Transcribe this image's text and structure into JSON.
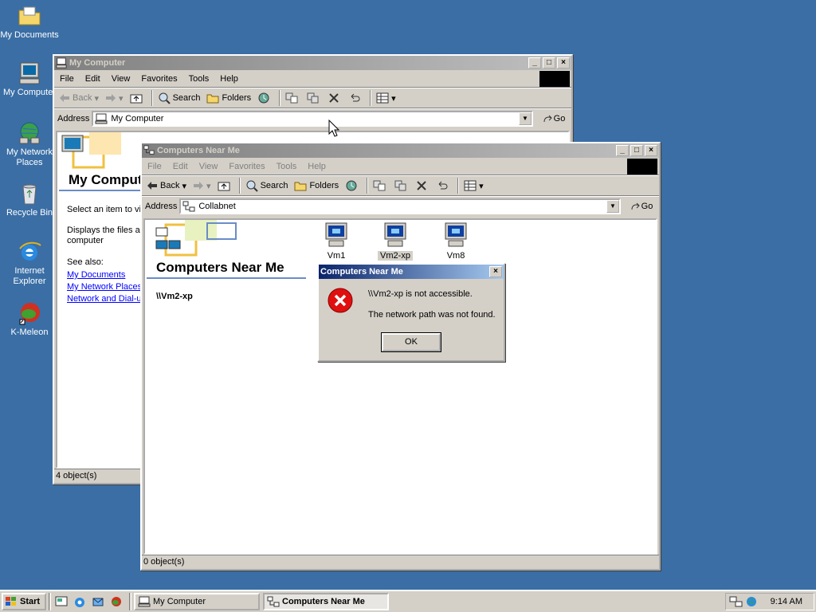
{
  "desktop": {
    "icons": [
      {
        "label": "My Documents"
      },
      {
        "label": "My Computer"
      },
      {
        "label": "My Network Places"
      },
      {
        "label": "Recycle Bin"
      },
      {
        "label": "Internet Explorer"
      },
      {
        "label": "K-Meleon"
      }
    ]
  },
  "win_mycomputer": {
    "title": "My Computer",
    "menu": [
      "File",
      "Edit",
      "View",
      "Favorites",
      "Tools",
      "Help"
    ],
    "toolbar": {
      "back": "Back",
      "search": "Search",
      "folders": "Folders"
    },
    "address_label": "Address",
    "address_value": "My Computer",
    "go": "Go",
    "heading": "My Computer",
    "select_text": "Select an item to vi",
    "displays_text": "Displays the files and folders on your computer",
    "displays_line1": "Displays the files ar",
    "displays_line2": "computer",
    "see_also": "See also:",
    "links": [
      "My Documents",
      "My Network Places",
      "Network and Dial-up"
    ],
    "status": "4 object(s)"
  },
  "win_near": {
    "title": "Computers Near Me",
    "menu": [
      "File",
      "Edit",
      "View",
      "Favorites",
      "Tools",
      "Help"
    ],
    "toolbar": {
      "back": "Back",
      "search": "Search",
      "folders": "Folders"
    },
    "address_label": "Address",
    "address_value": "Collabnet",
    "go": "Go",
    "heading": "Computers Near Me",
    "selected_item": "\\\\Vm2-xp",
    "computers": [
      {
        "label": "Vm1",
        "selected": false
      },
      {
        "label": "Vm2-xp",
        "selected": true
      },
      {
        "label": "Vm8",
        "selected": false
      }
    ],
    "status": "0 object(s)"
  },
  "dialog": {
    "title": "Computers Near Me",
    "message1": "\\\\Vm2-xp is not accessible.",
    "message2": "The network path was not found.",
    "ok": "OK"
  },
  "taskbar": {
    "start": "Start",
    "tasks": [
      {
        "label": "My Computer",
        "active": false
      },
      {
        "label": "Computers Near Me",
        "active": true
      }
    ],
    "clock": "9:14 AM"
  }
}
